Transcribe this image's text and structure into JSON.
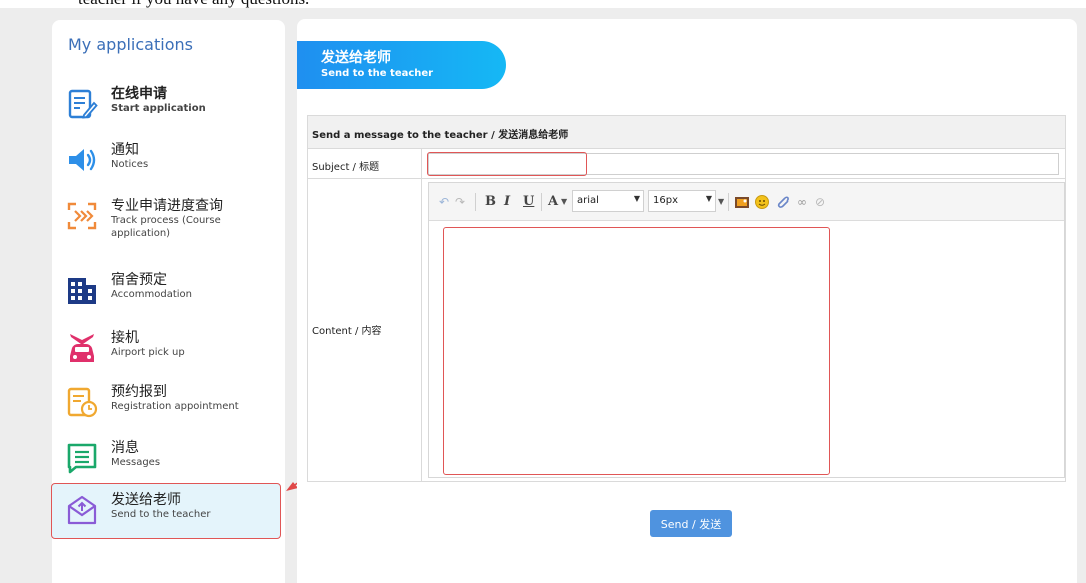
{
  "top_text": "teacher if you have any questions.",
  "sidebar": {
    "title": "My applications",
    "items": [
      {
        "zh": "在线申请",
        "en": "Start application"
      },
      {
        "zh": "通知",
        "en": "Notices"
      },
      {
        "zh": "专业申请进度查询",
        "en": "Track process (Course application)"
      },
      {
        "zh": "宿舍预定",
        "en": "Accommodation"
      },
      {
        "zh": "接机",
        "en": "Airport pick up"
      },
      {
        "zh": "预约报到",
        "en": "Registration appointment"
      },
      {
        "zh": "消息",
        "en": "Messages"
      },
      {
        "zh": "发送给老师",
        "en": "Send to the teacher"
      }
    ]
  },
  "main": {
    "tab": {
      "zh": "发送给老师",
      "en": "Send to the teacher"
    },
    "form_title": "Send a message to the teacher / 发送消息给老师",
    "subject_label": "Subject / 标题",
    "subject_value": "",
    "content_label": "Content / 内容",
    "editor": {
      "bold": "B",
      "italic": "I",
      "underline": "U",
      "font_color": "A",
      "font_family": "arial",
      "font_size": "16px"
    },
    "send_label": "Send / 发送"
  },
  "colors": {
    "accent": "#1f8ff0",
    "highlight_red": "#e05656",
    "sidebar_title": "#3b6fb8",
    "active_bg": "#e4f4fb",
    "send_button": "#4f93df"
  }
}
